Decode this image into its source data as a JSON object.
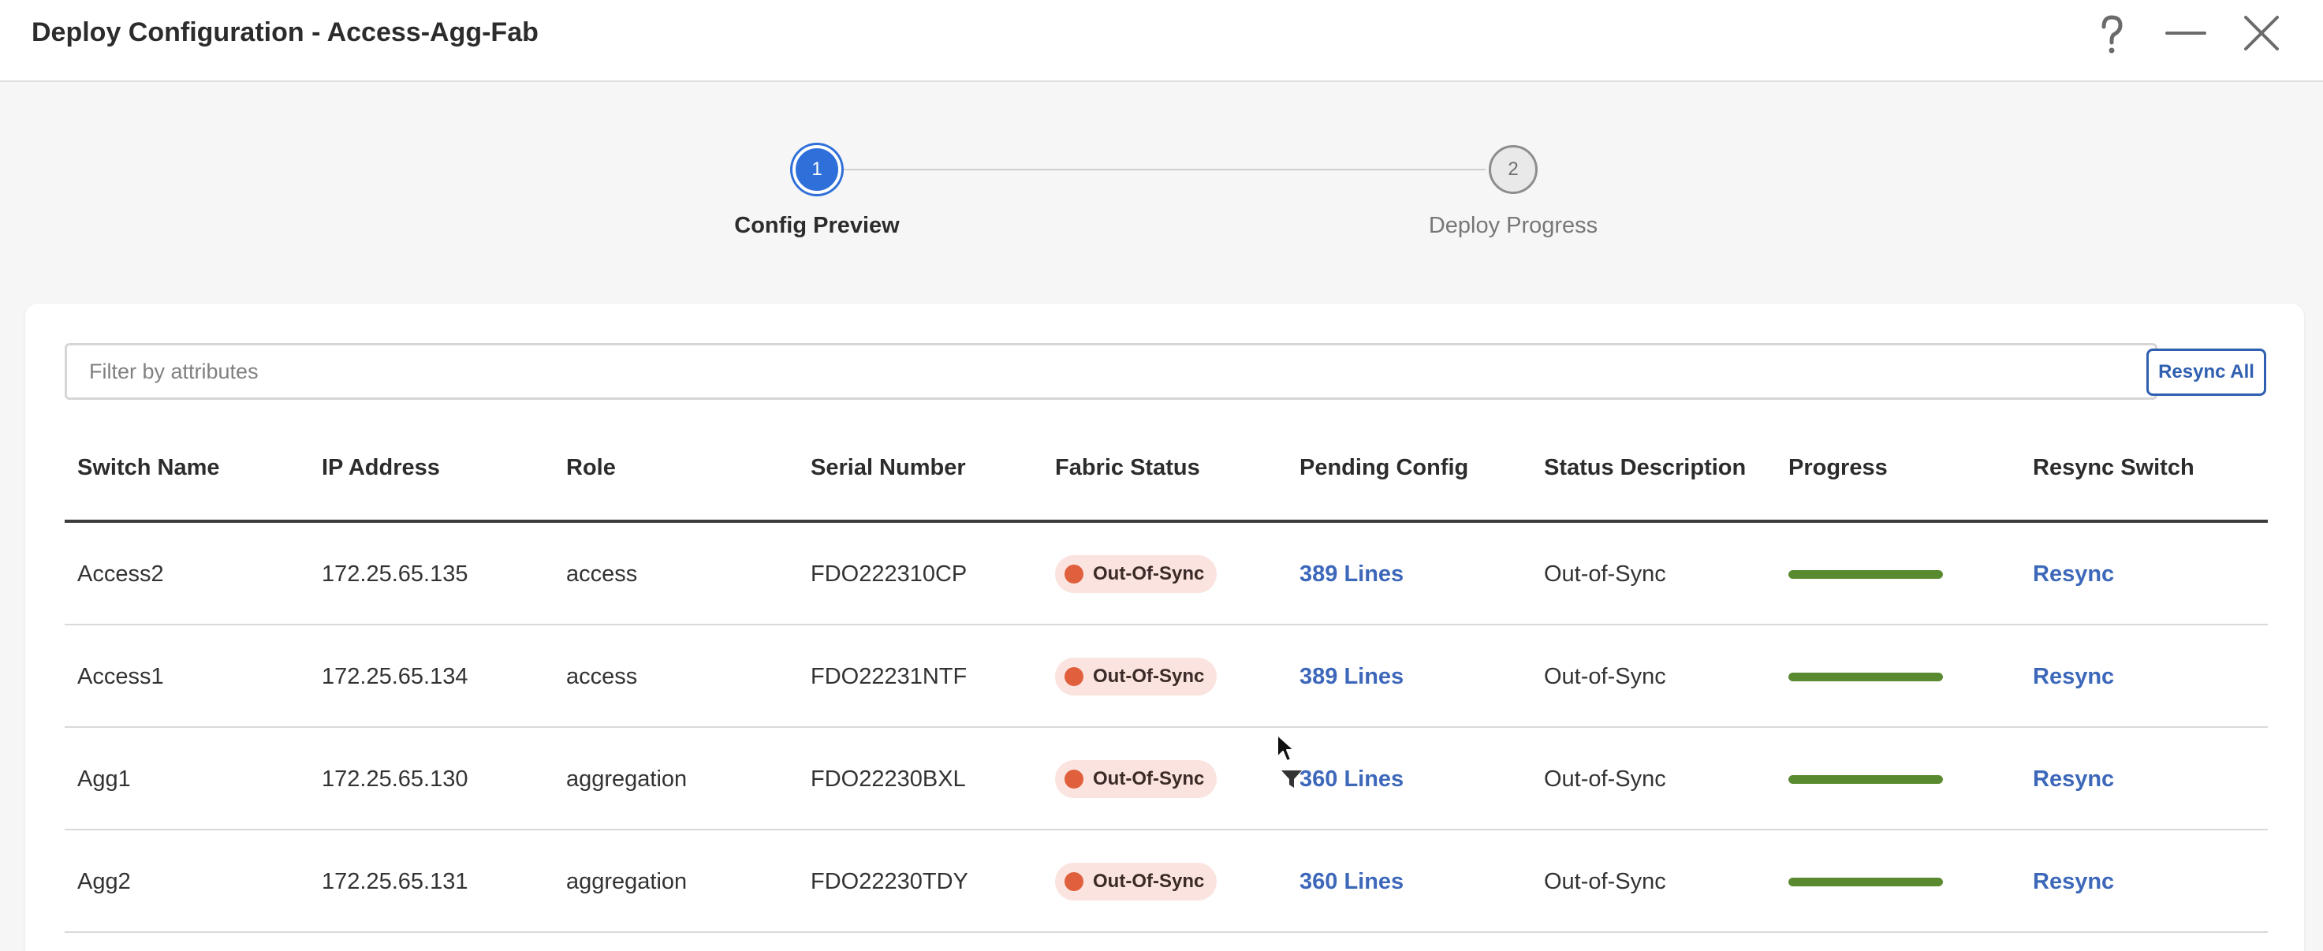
{
  "window": {
    "title": "Deploy Configuration - Access-Agg-Fab",
    "help_icon": "help-icon",
    "minimize_icon": "minimize-icon",
    "close_icon": "close-icon"
  },
  "stepper": {
    "steps": [
      {
        "number": "1",
        "label": "Config Preview",
        "state": "active"
      },
      {
        "number": "2",
        "label": "Deploy Progress",
        "state": "inactive"
      }
    ]
  },
  "toolbar": {
    "filter_placeholder": "Filter by attributes",
    "filter_value": "",
    "resync_all_label": "Resync All"
  },
  "table": {
    "columns": [
      "Switch Name",
      "IP Address",
      "Role",
      "Serial Number",
      "Fabric Status",
      "Pending Config",
      "Status Description",
      "Progress",
      "Resync Switch"
    ],
    "rows": [
      {
        "switch_name": "Access2",
        "ip": "172.25.65.135",
        "role": "access",
        "serial": "FDO222310CP",
        "fabric_status": "Out-Of-Sync",
        "pending_config": "389 Lines",
        "status_description": "Out-of-Sync",
        "progress": 1.0,
        "resync": "Resync"
      },
      {
        "switch_name": "Access1",
        "ip": "172.25.65.134",
        "role": "access",
        "serial": "FDO22231NTF",
        "fabric_status": "Out-Of-Sync",
        "pending_config": "389 Lines",
        "status_description": "Out-of-Sync",
        "progress": 1.0,
        "resync": "Resync"
      },
      {
        "switch_name": "Agg1",
        "ip": "172.25.65.130",
        "role": "aggregation",
        "serial": "FDO22230BXL",
        "fabric_status": "Out-Of-Sync",
        "pending_config": "360 Lines",
        "status_description": "Out-of-Sync",
        "progress": 1.0,
        "resync": "Resync"
      },
      {
        "switch_name": "Agg2",
        "ip": "172.25.65.131",
        "role": "aggregation",
        "serial": "FDO22230TDY",
        "fabric_status": "Out-Of-Sync",
        "pending_config": "360 Lines",
        "status_description": "Out-of-Sync",
        "progress": 1.0,
        "resync": "Resync"
      }
    ]
  },
  "colors": {
    "accent": "#2f6fd9",
    "link": "#3d68ba",
    "out_of_sync_dot": "#e0603d",
    "out_of_sync_badge_bg": "#fbe3df",
    "progress_fill": "#5a8a30"
  }
}
